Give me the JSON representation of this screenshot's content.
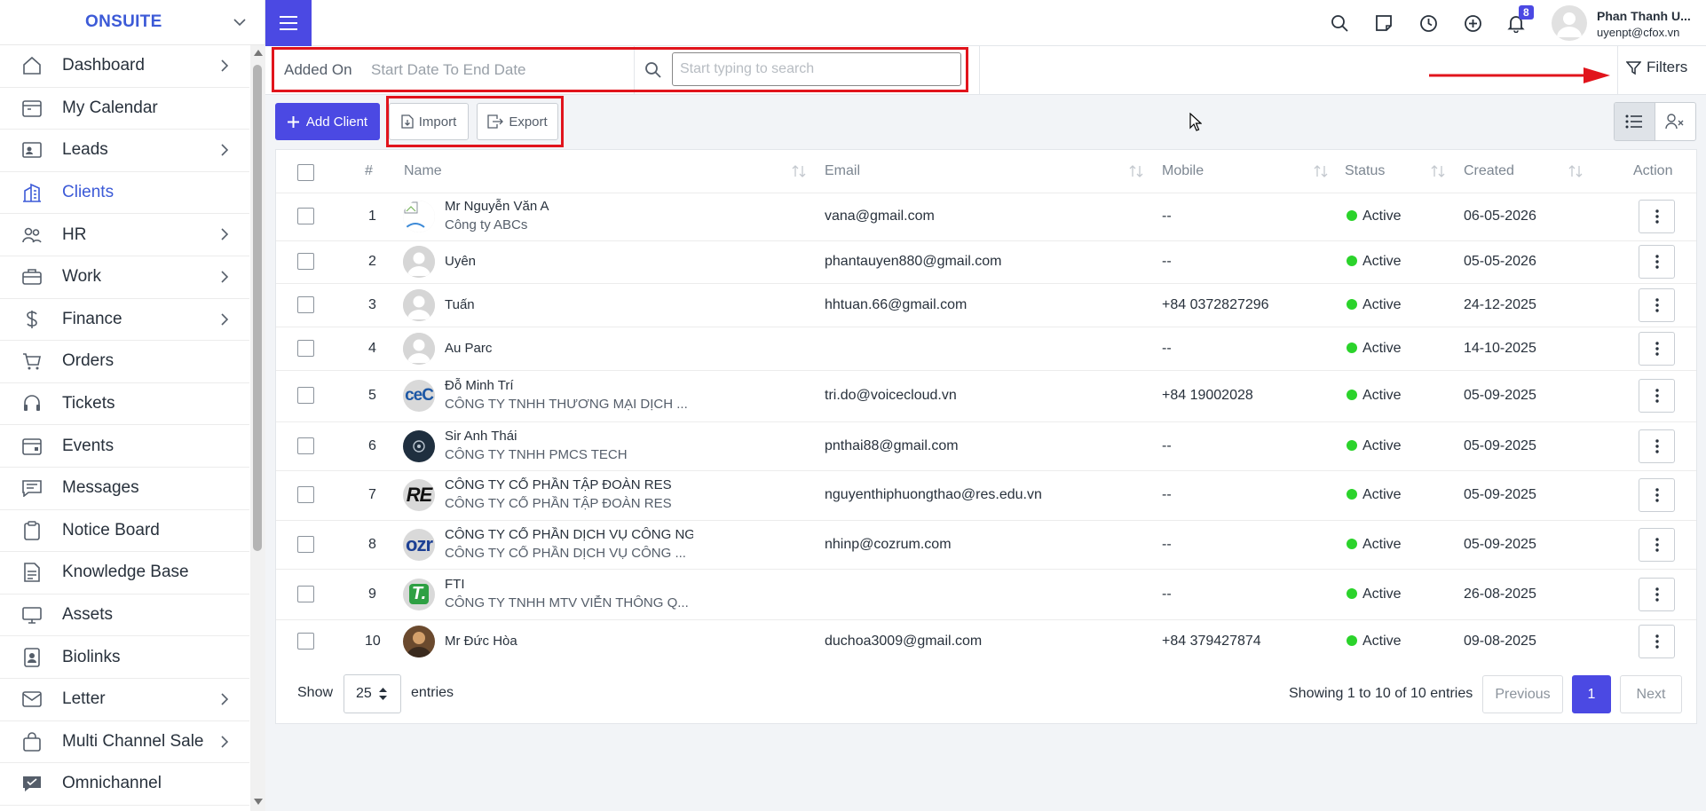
{
  "brand": {
    "name": "ONSUITE"
  },
  "sidebar": {
    "items": [
      {
        "label": "Dashboard",
        "icon": "home-icon",
        "chevron": true
      },
      {
        "label": "My Calendar",
        "icon": "calendar-icon",
        "chevron": false
      },
      {
        "label": "Leads",
        "icon": "contact-card-icon",
        "chevron": true
      },
      {
        "label": "Clients",
        "icon": "building-icon",
        "chevron": false,
        "active": true
      },
      {
        "label": "HR",
        "icon": "people-icon",
        "chevron": true
      },
      {
        "label": "Work",
        "icon": "briefcase-icon",
        "chevron": true
      },
      {
        "label": "Finance",
        "icon": "dollar-icon",
        "chevron": true
      },
      {
        "label": "Orders",
        "icon": "cart-icon",
        "chevron": false
      },
      {
        "label": "Tickets",
        "icon": "headset-icon",
        "chevron": false
      },
      {
        "label": "Events",
        "icon": "calendar-event-icon",
        "chevron": false
      },
      {
        "label": "Messages",
        "icon": "chat-icon",
        "chevron": false
      },
      {
        "label": "Notice Board",
        "icon": "clipboard-icon",
        "chevron": false
      },
      {
        "label": "Knowledge Base",
        "icon": "document-icon",
        "chevron": false
      },
      {
        "label": "Assets",
        "icon": "monitor-icon",
        "chevron": false
      },
      {
        "label": "Biolinks",
        "icon": "badge-icon",
        "chevron": false
      },
      {
        "label": "Letter",
        "icon": "envelope-icon",
        "chevron": true
      },
      {
        "label": "Multi Channel Sale",
        "icon": "bag-icon",
        "chevron": true
      },
      {
        "label": "Omnichannel",
        "icon": "chat-bubble-icon",
        "chevron": false
      }
    ]
  },
  "topbar": {
    "notification_count": "8",
    "user_name": "Phan Thanh U...",
    "user_email": "uyenpt@cfox.vn"
  },
  "filters": {
    "added_on_label": "Added On",
    "date_range_placeholder": "Start Date To End Date",
    "search_placeholder": "Start typing to search",
    "filters_label": "Filters"
  },
  "actions": {
    "add_client": "Add Client",
    "import": "Import",
    "export": "Export"
  },
  "table": {
    "headers": {
      "num": "#",
      "name": "Name",
      "email": "Email",
      "mobile": "Mobile",
      "status": "Status",
      "created": "Created",
      "action": "Action"
    },
    "rows": [
      {
        "num": "1",
        "name": "Mr Nguyễn Văn A",
        "company": "Công ty ABCs",
        "email": "vana@gmail.com",
        "mobile": "--",
        "status": "Active",
        "created": "06-05-2026",
        "avatar": "broken-image"
      },
      {
        "num": "2",
        "name": "Uyên",
        "company": "",
        "email": "phantauyen880@gmail.com",
        "mobile": "--",
        "status": "Active",
        "created": "05-05-2026",
        "avatar": "default-user"
      },
      {
        "num": "3",
        "name": "Tuấn",
        "company": "",
        "email": "hhtuan.66@gmail.com",
        "mobile": "+84 0372827296",
        "status": "Active",
        "created": "24-12-2025",
        "avatar": "default-user"
      },
      {
        "num": "4",
        "name": "Au Parc",
        "company": "",
        "email": "",
        "mobile": "--",
        "status": "Active",
        "created": "14-10-2025",
        "avatar": "default-user"
      },
      {
        "num": "5",
        "name": "Đỗ Minh Trí",
        "company": "CÔNG TY TNHH THƯƠNG MẠI DỊCH ...",
        "email": "tri.do@voicecloud.vn",
        "mobile": "+84 19002028",
        "status": "Active",
        "created": "05-09-2025",
        "avatar": "logo-ce",
        "avatar_text": "ceC"
      },
      {
        "num": "6",
        "name": "Sir Anh Thái",
        "company": "CÔNG TY TNHH PMCS TECH",
        "email": "pnthai88@gmail.com",
        "mobile": "--",
        "status": "Active",
        "created": "05-09-2025",
        "avatar": "logo-dark"
      },
      {
        "num": "7",
        "name": "CÔNG TY CỔ PHẦN TẬP ĐOÀN RES",
        "company": "CÔNG TY CỔ PHẦN TẬP ĐOÀN RES",
        "email": "nguyenthiphuongthao@res.edu.vn",
        "mobile": "--",
        "status": "Active",
        "created": "05-09-2025",
        "avatar": "logo-re",
        "avatar_text": "RE"
      },
      {
        "num": "8",
        "name": "CÔNG TY CỔ PHẦN DỊCH VỤ CÔNG NG",
        "company": "CÔNG TY CỔ PHẦN DỊCH VỤ CÔNG ...",
        "email": "nhinp@cozrum.com",
        "mobile": "--",
        "status": "Active",
        "created": "05-09-2025",
        "avatar": "logo-ozr",
        "avatar_text": "ozr"
      },
      {
        "num": "9",
        "name": "FTI",
        "company": "CÔNG TY TNHH MTV VIỄN THÔNG Q...",
        "email": "",
        "mobile": "--",
        "status": "Active",
        "created": "26-08-2025",
        "avatar": "logo-fti",
        "avatar_text": "T."
      },
      {
        "num": "10",
        "name": "Mr Đức Hòa",
        "company": "",
        "email": "duchoa3009@gmail.com",
        "mobile": "+84 379427874",
        "status": "Active",
        "created": "09-08-2025",
        "avatar": "photo"
      }
    ]
  },
  "footer": {
    "show": "Show",
    "page_length": "25",
    "entries": "entries",
    "info": "Showing 1 to 10 of 10 entries",
    "previous": "Previous",
    "current_page": "1",
    "next": "Next"
  },
  "colors": {
    "accent": "#4b49e3",
    "brand": "#3c5ad7",
    "active_status": "#2bd32b",
    "highlight": "#e1141c"
  }
}
